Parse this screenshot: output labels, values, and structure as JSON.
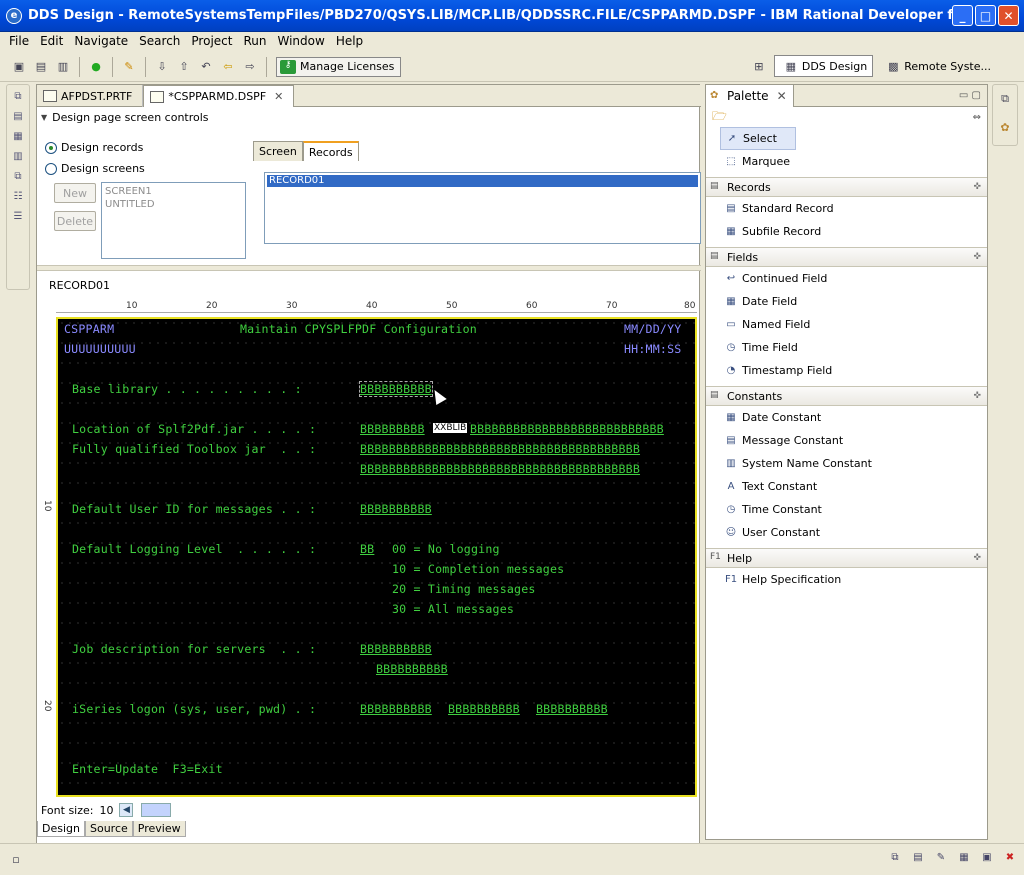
{
  "window": {
    "title": "DDS Design - RemoteSystemsTempFiles/PBD270/QSYS.LIB/MCP.LIB/QDDSSRC.FILE/CSPPARMD.DSPF - IBM Rational Developer for Power Systems Soft..."
  },
  "menu": [
    "File",
    "Edit",
    "Navigate",
    "Search",
    "Project",
    "Run",
    "Window",
    "Help"
  ],
  "toolbar": {
    "manage_licenses": "Manage Licenses"
  },
  "perspectives": {
    "dds": "DDS Design",
    "remote": "Remote Syste..."
  },
  "editor_tabs": [
    {
      "label": "AFPDST.PRTF"
    },
    {
      "label": "*CSPPARMD.DSPF"
    }
  ],
  "controls": {
    "header": "Design page screen controls",
    "design_records": "Design records",
    "design_screens": "Design screens",
    "new": "New",
    "delete": "Delete",
    "screens": [
      "SCREEN1",
      "UNTITLED"
    ],
    "tab_screen": "Screen",
    "tab_records": "Records",
    "records": [
      "RECORD01"
    ]
  },
  "record_name": "RECORD01",
  "ruler": {
    "h": [
      "10",
      "20",
      "30",
      "40",
      "50",
      "60",
      "70",
      "80"
    ],
    "v": [
      "10",
      "20"
    ]
  },
  "screen": {
    "program": "CSPPARM",
    "title": "Maintain CPYSPLFPDF Configuration",
    "date": "MM/DD/YY",
    "user": "UUUUUUUUUU",
    "time": "HH:MM:SS",
    "base_label": "Base library . . . . . . . . . :",
    "base_field": "BBBBBBBBBB",
    "loc_label": "Location of Splf2Pdf.jar . . . . :",
    "loc_field_a": "BBBBBBBBB",
    "loc_field_b": "BBBBBBBBBBBBBBBBBBBBBBBBBBB",
    "tooltip": "XXBLIB",
    "toolbox_label": "Fully qualified Toolbox jar  . . :",
    "toolbox_field1": "BBBBBBBBBBBBBBBBBBBBBBBBBBBBBBBBBBBBBBB",
    "toolbox_field2": "BBBBBBBBBBBBBBBBBBBBBBBBBBBBBBBBBBBBBBB",
    "userid_label": "Default User ID for messages . . :",
    "userid_field": "BBBBBBBBBB",
    "logging_label": "Default Logging Level  . . . . . :",
    "logging_field": "BB",
    "log0": "00 = No logging",
    "log10": "10 = Completion messages",
    "log20": "20 = Timing messages",
    "log30": "30 = All messages",
    "jobd_label": "Job description for servers  . . :",
    "jobd_field1": "BBBBBBBBBB",
    "jobd_field2": "BBBBBBBBBB",
    "logon_label": "iSeries logon (sys, user, pwd) . :",
    "logon_f1": "BBBBBBBBBB",
    "logon_f2": "BBBBBBBBBB",
    "logon_f3": "BBBBBBBBBB",
    "fkeys": "Enter=Update  F3=Exit"
  },
  "font_size": {
    "label": "Font size:",
    "value": "10"
  },
  "bottom_tabs": [
    "Design",
    "Source",
    "Preview"
  ],
  "palette": {
    "title": "Palette",
    "select": "Select",
    "marquee": "Marquee",
    "records_drawer": "Records",
    "records_items": [
      "Standard Record",
      "Subfile Record"
    ],
    "fields_drawer": "Fields",
    "fields_items": [
      "Continued Field",
      "Date Field",
      "Named Field",
      "Time Field",
      "Timestamp Field"
    ],
    "constants_drawer": "Constants",
    "constants_items": [
      "Date Constant",
      "Message Constant",
      "System Name Constant",
      "Text Constant",
      "Time Constant",
      "User Constant"
    ],
    "help_drawer": "Help",
    "help_items": [
      "Help Specification"
    ]
  }
}
